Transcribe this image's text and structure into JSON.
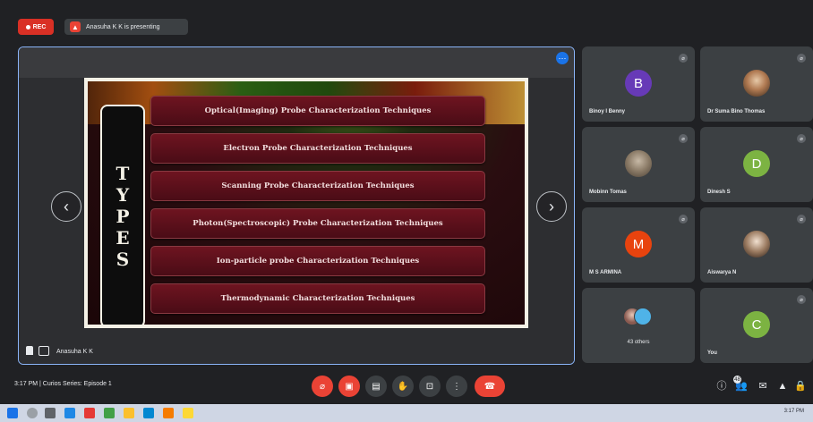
{
  "topbar": {
    "rec_label": "REC",
    "presenting_label": "Anasuha K K is presenting"
  },
  "share": {
    "presenter_name": "Anasuha K K",
    "slide": {
      "heading_letters": [
        "T",
        "Y",
        "P",
        "E",
        "S"
      ],
      "techniques": [
        "Optical(Imaging) Probe Characterization Techniques",
        "Electron Probe Characterization Techniques",
        "Scanning Probe Characterization Techniques",
        "Photon(Spectroscopic) Probe Characterization Techniques",
        "Ion-particle probe Characterization Techniques",
        "Thermodynamic Characterization Techniques"
      ]
    }
  },
  "participants": [
    {
      "name": "Binoy I Benny",
      "avatar_letter": "B",
      "avatar_color": "#673ab7",
      "type": "letter"
    },
    {
      "name": "Dr Suma Bino Thomas",
      "avatar_letter": "",
      "avatar_color": "",
      "type": "photo"
    },
    {
      "name": "Mobinn Tomas",
      "avatar_letter": "",
      "avatar_color": "",
      "type": "photo2"
    },
    {
      "name": "Dinesh S",
      "avatar_letter": "D",
      "avatar_color": "#7cb342",
      "type": "letter"
    },
    {
      "name": "M S ARMINA",
      "avatar_letter": "M",
      "avatar_color": "#e8430e",
      "type": "letter"
    },
    {
      "name": "Aiswarya N",
      "avatar_letter": "",
      "avatar_color": "",
      "type": "photo3"
    },
    {
      "name": "",
      "avatar_letter": "",
      "avatar_color": "",
      "type": "others",
      "others_label": "43 others"
    },
    {
      "name": "You",
      "avatar_letter": "C",
      "avatar_color": "#7cb342",
      "type": "letter"
    }
  ],
  "controls": {
    "time_label": "3:17 PM  |  Curios Series: Episode 1",
    "participants_badge": "48"
  },
  "taskbar": {
    "tray_text": "3:17 PM"
  }
}
